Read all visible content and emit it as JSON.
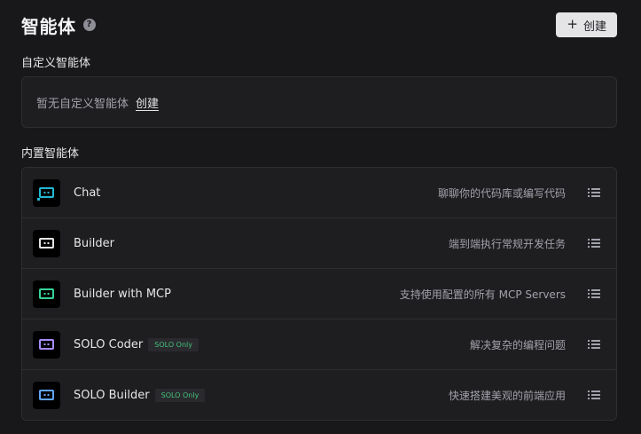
{
  "header": {
    "title": "智能体",
    "help_icon": "?",
    "create_button": {
      "icon": "+",
      "label": "创建"
    }
  },
  "custom_section": {
    "title": "自定义智能体",
    "empty_text": "暂无自定义智能体",
    "empty_link": "创建"
  },
  "builtin_section": {
    "title": "内置智能体",
    "agents": [
      {
        "name": "Chat",
        "badge": "",
        "description": "聊聊你的代码库或编写代码",
        "icon_color": "#22b8d4"
      },
      {
        "name": "Builder",
        "badge": "",
        "description": "端到端执行常规开发任务",
        "icon_color": "#e4e4e7"
      },
      {
        "name": "Builder with MCP",
        "badge": "",
        "description": "支持使用配置的所有 MCP Servers",
        "icon_color": "#34d399"
      },
      {
        "name": "SOLO Coder",
        "badge": "SOLO Only",
        "description": "解决复杂的编程问题",
        "icon_color": "#a78bfa"
      },
      {
        "name": "SOLO Builder",
        "badge": "SOLO Only",
        "description": "快速搭建美观的前端应用",
        "icon_color": "#60a5fa"
      }
    ]
  }
}
